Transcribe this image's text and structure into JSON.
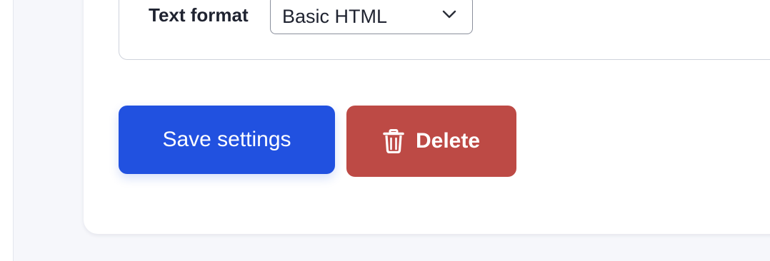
{
  "text_format": {
    "label": "Text format",
    "selected": "Basic HTML",
    "icon": "chevron-down-icon"
  },
  "actions": {
    "save_label": "Save settings",
    "delete_label": "Delete",
    "delete_icon": "trash-icon"
  },
  "colors": {
    "save_button": "#2151e0",
    "delete_button": "#bd4a45",
    "page_background": "#f6f7fb"
  }
}
